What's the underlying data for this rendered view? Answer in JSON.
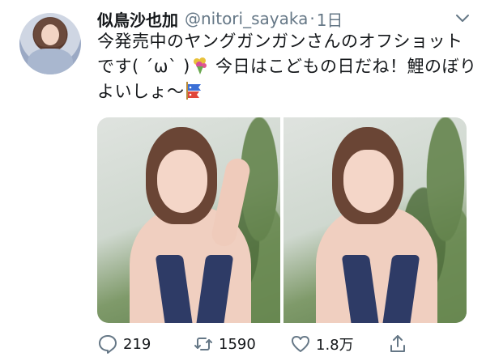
{
  "tweet": {
    "display_name": "似鳥沙也加",
    "handle": "@nitori_sayaka",
    "separator": "·",
    "time": "1日",
    "text_part1": "今発売中のヤングガンガンさんのオフショットです( ´ω` )",
    "text_part2": " 今日はこどもの日だね！鯉のぼりよいしょ〜",
    "emoji_1": "bouquet-emoji",
    "emoji_2": "koinobori-emoji"
  },
  "media": {
    "photo_count": 2
  },
  "actions": {
    "reply_count": "219",
    "retweet_count": "1590",
    "like_count": "1.8万"
  },
  "colors": {
    "text": "#14171a",
    "muted": "#657786"
  }
}
